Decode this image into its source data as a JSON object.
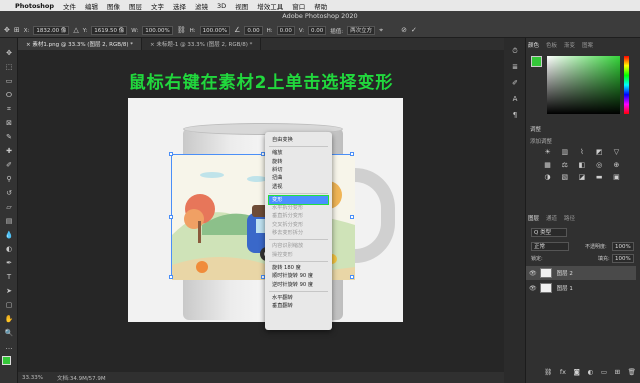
{
  "menubar": {
    "app": "Photoshop",
    "items": [
      "文件",
      "编辑",
      "图像",
      "图层",
      "文字",
      "选择",
      "滤镜",
      "3D",
      "视图",
      "增效工具",
      "窗口",
      "帮助"
    ]
  },
  "options": {
    "window_title": "Adobe Photoshop 2020",
    "x_label": "X:",
    "x_value": "1832.00 像",
    "y_label": "Y:",
    "y_value": "1619.50 像",
    "w_label": "W:",
    "w_value": "100.00%",
    "h_label": "H:",
    "h_value": "100.00%",
    "angle_value": "0.00",
    "h2_label": "H:",
    "h2_value": "0.00",
    "v_label": "V:",
    "v_value": "0.00",
    "interp_label": "插值:",
    "interp_value": "两次立方"
  },
  "tabs": [
    {
      "label": "素材1.png @ 33.3% (图层 2, RGB/8) *",
      "active": true
    },
    {
      "label": "未标题-1 @ 33.3% (图层 2, RGB/8) *",
      "active": false
    }
  ],
  "heading": "鼠标右键在素材2上单击选择变形",
  "context_menu": {
    "items": [
      {
        "label": "自由变换",
        "state": "normal"
      },
      {
        "sep": true
      },
      {
        "label": "缩放",
        "state": "normal"
      },
      {
        "label": "旋转",
        "state": "normal"
      },
      {
        "label": "斜切",
        "state": "normal"
      },
      {
        "label": "扭曲",
        "state": "normal"
      },
      {
        "label": "透视",
        "state": "normal"
      },
      {
        "sep": true
      },
      {
        "label": "变形",
        "state": "selected"
      },
      {
        "label": "水平拆分变形",
        "state": "disabled"
      },
      {
        "label": "垂直拆分变形",
        "state": "disabled"
      },
      {
        "label": "交叉拆分变形",
        "state": "disabled"
      },
      {
        "label": "移去变形拆分",
        "state": "disabled"
      },
      {
        "sep": true
      },
      {
        "label": "内容识别缩放",
        "state": "disabled"
      },
      {
        "label": "操控变形",
        "state": "disabled"
      },
      {
        "sep": true
      },
      {
        "label": "旋转 180 度",
        "state": "normal"
      },
      {
        "label": "顺时针旋转 90 度",
        "state": "normal"
      },
      {
        "label": "逆时针旋转 90 度",
        "state": "normal"
      },
      {
        "sep": true
      },
      {
        "label": "水平翻转",
        "state": "normal"
      },
      {
        "label": "垂直翻转",
        "state": "normal"
      }
    ]
  },
  "status": {
    "zoom": "33.33%",
    "doc": "文档:34.9M/57.9M"
  },
  "panels": {
    "color_tabs": [
      "颜色",
      "色板",
      "渐变",
      "图案"
    ],
    "adjust_title": "调整",
    "adjust_sub": "添加调整",
    "layers_tabs": [
      "图层",
      "通道",
      "路径"
    ],
    "filter_kind": "Q 类型",
    "blend_mode": "正常",
    "opacity_label": "不透明度:",
    "opacity_value": "100%",
    "lock_label": "锁定:",
    "fill_label": "填充:",
    "fill_value": "100%",
    "layers": [
      {
        "name": "图层 2",
        "selected": true
      },
      {
        "name": "图层 1",
        "selected": false
      }
    ]
  },
  "colors": {
    "accent": "#21d83d",
    "selection": "#4b8ff7",
    "menu_highlight": "#4a90ff",
    "foreground": "#35c83a",
    "background_swatch": "#2b63c9"
  }
}
